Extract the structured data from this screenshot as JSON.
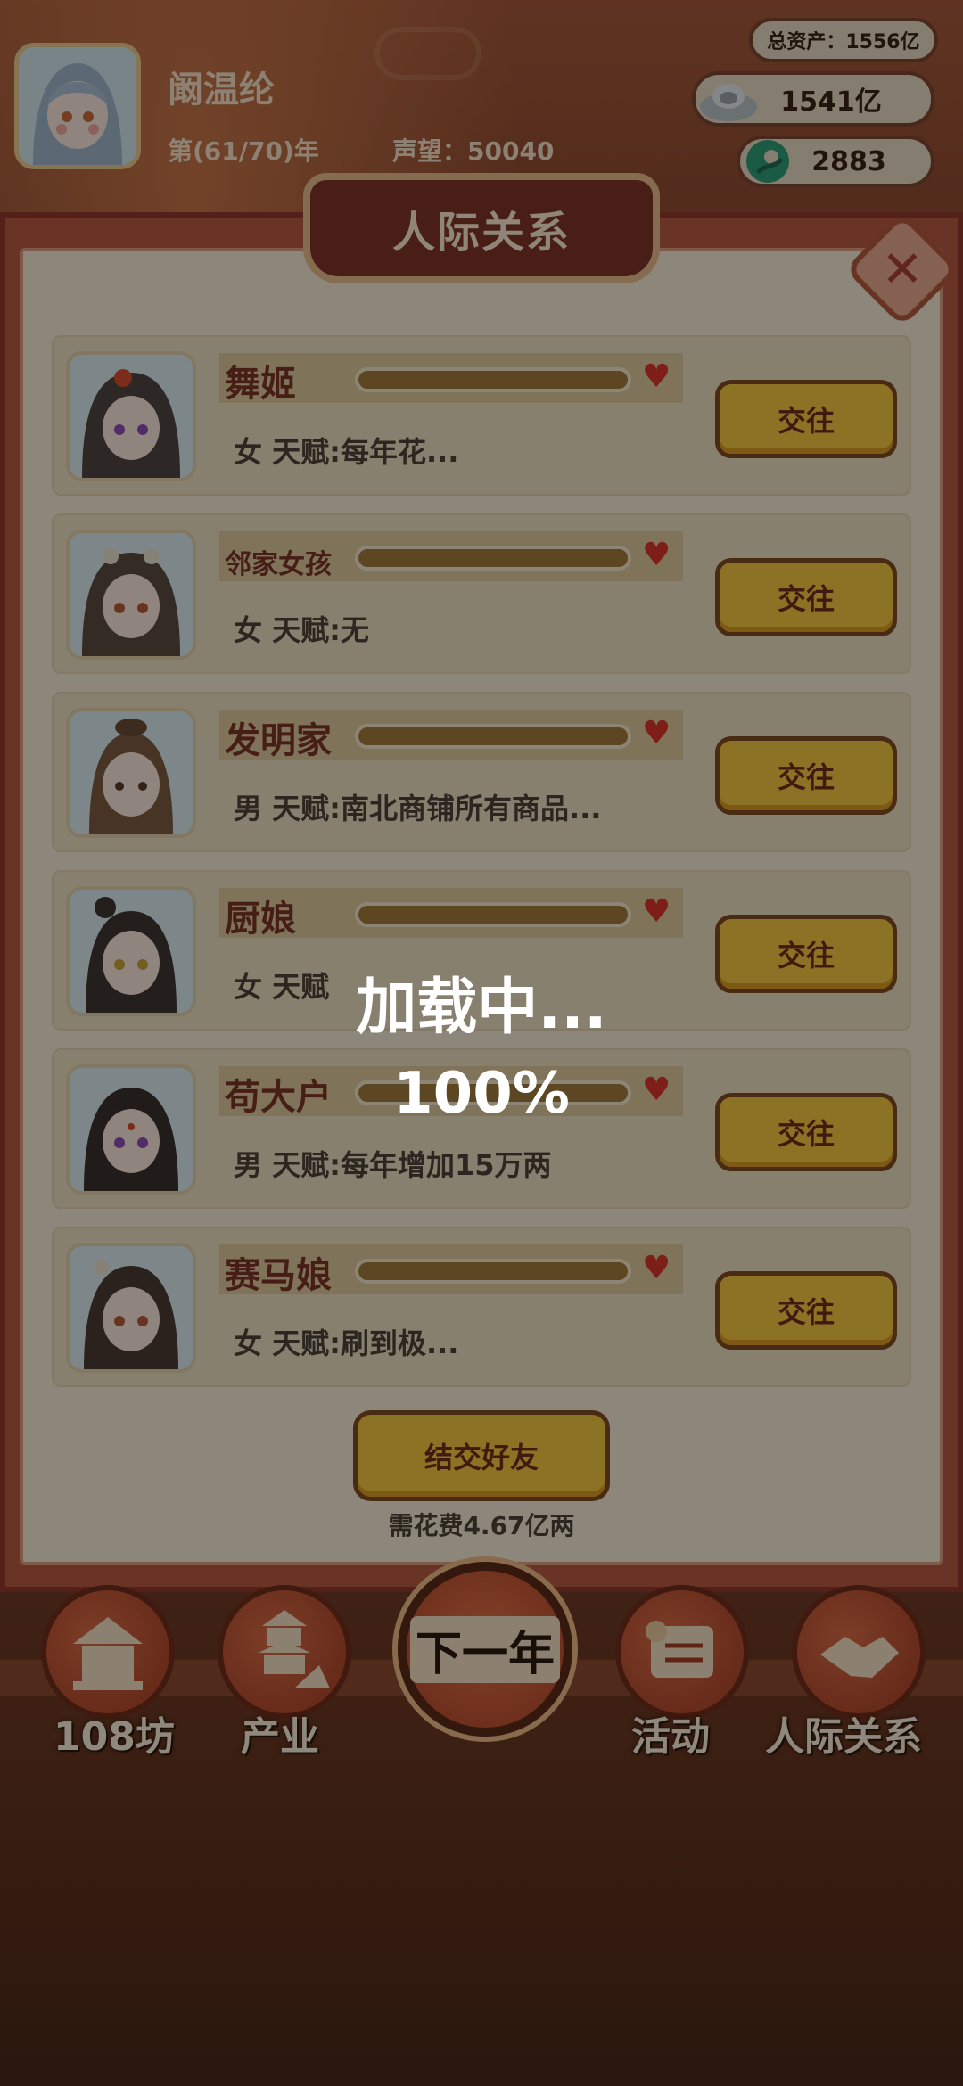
{
  "header": {
    "player_name": "阚温纶",
    "year": "第(61/70)年",
    "fame": "声望：50040"
  },
  "resources": {
    "total_assets": "总资产：1556亿",
    "silver": "1541亿",
    "jade": "2883"
  },
  "panel": {
    "title": "人际关系"
  },
  "contacts": [
    {
      "name": "舞姬",
      "info": "女  天赋:每年花...",
      "button": "交往"
    },
    {
      "name": "邻家女孩",
      "info": "女  天赋:无",
      "button": "交往"
    },
    {
      "name": "发明家",
      "info": "男  天赋:南北商铺所有商品...",
      "button": "交往"
    },
    {
      "name": "厨娘",
      "info": "女  天赋",
      "button": "交往"
    },
    {
      "name": "苟大户",
      "info": "男  天赋:每年增加15万两",
      "button": "交往"
    },
    {
      "name": "赛马娘",
      "info": "女  天赋:刷到极...",
      "button": "交往"
    }
  ],
  "actions": {
    "make_friend": "结交好友",
    "cost": "需花费4.67亿两"
  },
  "nav": {
    "item1": "108坊",
    "item2": "产业",
    "next_year": "下一年",
    "item4": "活动",
    "item5": "人际关系"
  },
  "loading": {
    "text": "加载中...",
    "percent": "100%"
  }
}
